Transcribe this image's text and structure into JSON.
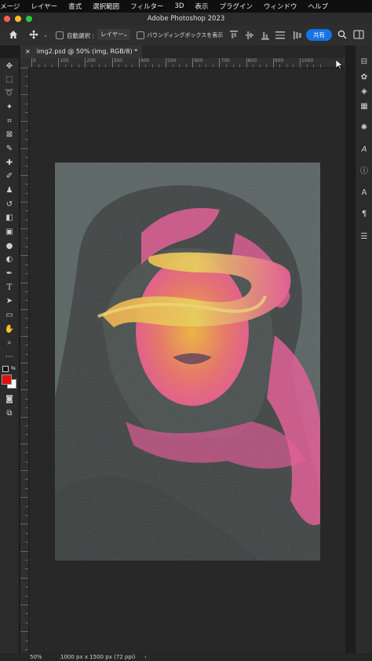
{
  "menu": [
    "メージ",
    "レイヤー",
    "書式",
    "選択範囲",
    "フィルター",
    "3D",
    "表示",
    "プラグイン",
    "ウィンドウ",
    "ヘルプ"
  ],
  "window_title": "Adobe Photoshop 2023",
  "options": {
    "auto_select_label": "自動選択 :",
    "auto_select_target": "レイヤー",
    "bounding_box_label": "バウンディングボックスを表示",
    "share_label": "共有"
  },
  "document_tab": {
    "close_glyph": "×",
    "title": "img2.psd @ 50% (img, RGB/8) *"
  },
  "ruler_labels": [
    "0",
    "100",
    "200",
    "300",
    "400",
    "500",
    "600",
    "700",
    "800",
    "900",
    "1000"
  ],
  "status": {
    "zoom": "50%",
    "dimensions": "1000 px x 1500 px (72 ppi)",
    "arrow": "›"
  },
  "colors": {
    "foreground": "#e01010",
    "background": "#ffffff",
    "share_button": "#1473e6",
    "canvas_bg": "#282828"
  },
  "tools": [
    "move-icon",
    "marquee-icon",
    "lasso-icon",
    "magic-wand-icon",
    "crop-icon",
    "frame-icon",
    "eyedropper-icon",
    "healing-icon",
    "brush-icon",
    "stamp-icon",
    "history-brush-icon",
    "eraser-icon",
    "gradient-icon",
    "blur-icon",
    "dodge-icon",
    "pen-icon",
    "type-icon",
    "path-select-icon",
    "rectangle-icon",
    "hand-icon",
    "zoom-icon",
    "more-icon"
  ],
  "panel_icons": [
    "properties-icon",
    "color-icon",
    "layers-icon",
    "channels-icon",
    "adjustments-icon",
    "glyphs-icon",
    "info-icon",
    "character-icon",
    "paragraph-icon",
    "sliders-icon"
  ]
}
